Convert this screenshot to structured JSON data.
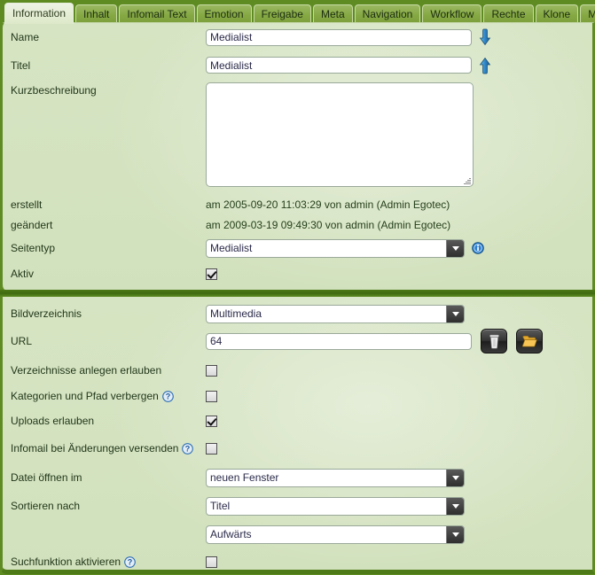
{
  "tabs": [
    {
      "label": "Information",
      "active": true
    },
    {
      "label": "Inhalt",
      "active": false
    },
    {
      "label": "Infomail Text",
      "active": false
    },
    {
      "label": "Emotion",
      "active": false
    },
    {
      "label": "Freigabe",
      "active": false
    },
    {
      "label": "Meta",
      "active": false
    },
    {
      "label": "Navigation",
      "active": false
    },
    {
      "label": "Workflow",
      "active": false
    },
    {
      "label": "Rechte",
      "active": false
    },
    {
      "label": "Klone",
      "active": false
    },
    {
      "label": "Media",
      "active": false
    }
  ],
  "info_section": {
    "name_label": "Name",
    "name_value": "Medialist",
    "titel_label": "Titel",
    "titel_value": "Medialist",
    "kurzbeschreibung_label": "Kurzbeschreibung",
    "kurzbeschreibung_value": "",
    "erstellt_label": "erstellt",
    "erstellt_value": "am 2005-09-20 11:03:29 von admin (Admin Egotec)",
    "geaendert_label": "geändert",
    "geaendert_value": "am 2009-03-19 09:49:30 von admin (Admin Egotec)",
    "seitentyp_label": "Seitentyp",
    "seitentyp_value": "Medialist",
    "aktiv_label": "Aktiv",
    "aktiv_checked": true
  },
  "media_section": {
    "bildverzeichnis_label": "Bildverzeichnis",
    "bildverzeichnis_value": "Multimedia",
    "url_label": "URL",
    "url_value": "64",
    "verzeichnisse_label": "Verzeichnisse anlegen erlauben",
    "verzeichnisse_checked": false,
    "kategorien_label": "Kategorien und Pfad verbergen",
    "kategorien_checked": false,
    "uploads_label": "Uploads erlauben",
    "uploads_checked": true,
    "infomail_label": "Infomail bei Änderungen versenden",
    "infomail_checked": false,
    "datei_oeffnen_label": "Datei öffnen im",
    "datei_oeffnen_value": "neuen Fenster",
    "sortieren_label": "Sortieren nach",
    "sortieren_value": "Titel",
    "sortieren_dir_value": "Aufwärts",
    "suchfunktion_label": "Suchfunktion aktivieren",
    "suchfunktion_checked": false
  },
  "icons": {
    "move_down": "arrow-down-icon",
    "move_up": "arrow-up-icon",
    "seitentyp_info": "info-icon",
    "delete": "trash-icon",
    "browse": "folder-icon",
    "help": "help-icon"
  },
  "colors": {
    "tabbar_green": "#5e8c22",
    "panel_green": "#d6e4c2",
    "active_tab": "#dfe9cd",
    "accent_blue": "#2f7fd0"
  }
}
